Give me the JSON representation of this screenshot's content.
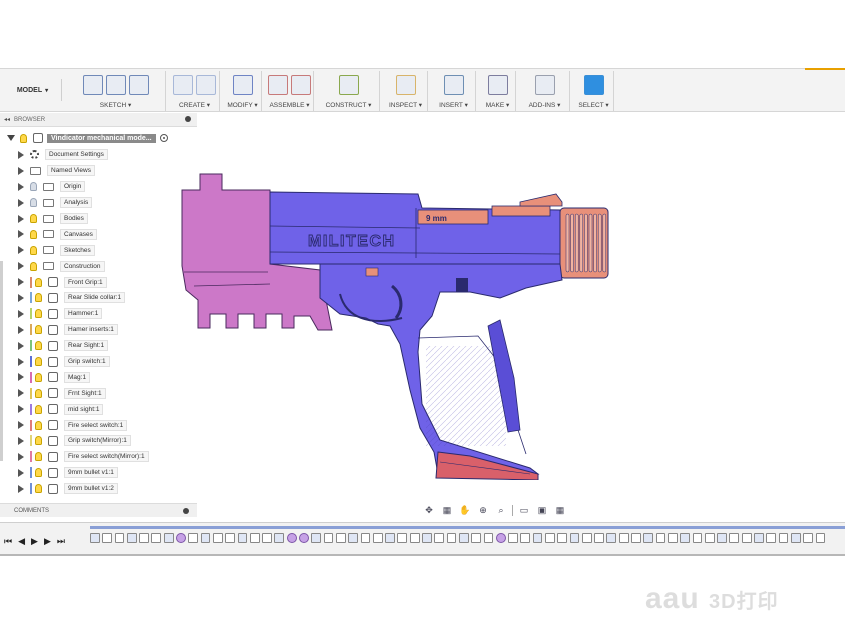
{
  "toolbar": {
    "workspace": "MODEL",
    "groups": [
      {
        "label": "SKETCH ▾",
        "icons": [
          "sketch-create-icon",
          "line-icon",
          "rectangle-icon"
        ]
      },
      {
        "label": "CREATE ▾",
        "icons": [
          "extrude-icon",
          "form-icon"
        ]
      },
      {
        "label": "MODIFY ▾",
        "icons": [
          "press-pull-icon"
        ]
      },
      {
        "label": "ASSEMBLE ▾",
        "icons": [
          "new-component-icon",
          "joint-icon"
        ]
      },
      {
        "label": "CONSTRUCT ▾",
        "icons": [
          "offset-plane-icon"
        ]
      },
      {
        "label": "INSPECT ▾",
        "icons": [
          "measure-icon"
        ]
      },
      {
        "label": "INSERT ▾",
        "icons": [
          "insert-image-icon"
        ]
      },
      {
        "label": "MAKE ▾",
        "icons": [
          "3d-print-icon"
        ]
      },
      {
        "label": "ADD-INS ▾",
        "icons": [
          "scripts-icon"
        ]
      },
      {
        "label": "SELECT ▾",
        "icons": [
          "select-cursor-icon"
        ]
      }
    ]
  },
  "browser": {
    "header": "BROWSER",
    "root": "Vindicator mechanical mode...",
    "items": [
      {
        "label": "Document Settings",
        "kind": "gear",
        "bulb": "none",
        "color": ""
      },
      {
        "label": "Named Views",
        "kind": "folder",
        "bulb": "none",
        "color": ""
      },
      {
        "label": "Origin",
        "kind": "folder",
        "bulb": "off",
        "color": ""
      },
      {
        "label": "Analysis",
        "kind": "folder",
        "bulb": "off",
        "color": ""
      },
      {
        "label": "Bodies",
        "kind": "folder",
        "bulb": "on",
        "color": ""
      },
      {
        "label": "Canvases",
        "kind": "folder",
        "bulb": "on",
        "color": ""
      },
      {
        "label": "Sketches",
        "kind": "folder",
        "bulb": "on",
        "color": ""
      },
      {
        "label": "Construction",
        "kind": "folder",
        "bulb": "on",
        "color": ""
      },
      {
        "label": "Front Grip:1",
        "kind": "comp",
        "bulb": "on",
        "color": "#d98a6a"
      },
      {
        "label": "Rear Slide collar:1",
        "kind": "comp",
        "bulb": "on",
        "color": "#7aa6d8"
      },
      {
        "label": "Hammer:1",
        "kind": "comp",
        "bulb": "on",
        "color": "#b5d36a"
      },
      {
        "label": "Hamer inserts:1",
        "kind": "comp",
        "bulb": "on",
        "color": "#d9a95c"
      },
      {
        "label": "Rear Sight:1",
        "kind": "comp",
        "bulb": "on",
        "color": "#7cc37a"
      },
      {
        "label": "Grip switch:1",
        "kind": "comp",
        "bulb": "on",
        "color": "#5b6fd6"
      },
      {
        "label": "Mag:1",
        "kind": "comp",
        "bulb": "on",
        "color": "#d66bb1"
      },
      {
        "label": "Frnt Sight:1",
        "kind": "comp",
        "bulb": "on",
        "color": "#e0c55a"
      },
      {
        "label": "mid sight:1",
        "kind": "comp",
        "bulb": "on",
        "color": "#9d7be0"
      },
      {
        "label": "Fire select switch:1",
        "kind": "comp",
        "bulb": "on",
        "color": "#e07a7a"
      },
      {
        "label": "Grip switch(Mirror):1",
        "kind": "comp",
        "bulb": "on",
        "color": "#e0d47a"
      },
      {
        "label": "Fire select switch(Mirror):1",
        "kind": "comp",
        "bulb": "on",
        "color": "#e07aa3"
      },
      {
        "label": "9mm bullet v1:1",
        "kind": "link",
        "bulb": "on",
        "color": "#6f8fd6"
      },
      {
        "label": "9mm bullet v1:2",
        "kind": "link",
        "bulb": "on",
        "color": "#6f8fd6"
      }
    ]
  },
  "comments": {
    "header": "COMMENTS"
  },
  "model": {
    "brand_text": "MILITECH",
    "caliber_text": "9 mm",
    "colors": {
      "frame": "#6f62e8",
      "slide_rear": "#cc78c8",
      "accent": "#e8907a",
      "mag_base": "#d9606a",
      "outline": "#2a2a6e"
    }
  },
  "navbar": {
    "icons": [
      "orbit-icon",
      "look-at-icon",
      "pan-icon",
      "zoom-icon",
      "zoom-window-icon",
      "display-settings-icon",
      "visual-style-icon",
      "grid-settings-icon"
    ]
  },
  "timeline": {
    "controls": [
      "go-to-start-icon",
      "step-back-icon",
      "play-icon",
      "step-forward-icon",
      "go-to-end-icon"
    ],
    "feature_count": 60
  },
  "watermark": {
    "text": "aau",
    "suffix": "3D打印"
  }
}
